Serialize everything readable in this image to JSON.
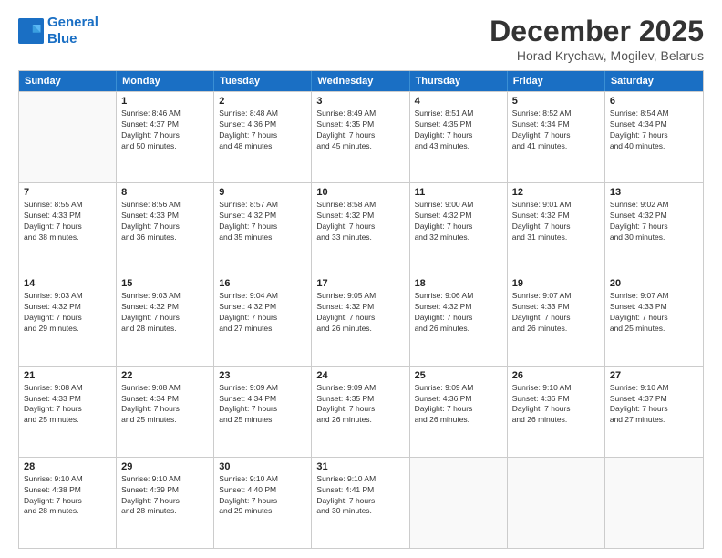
{
  "header": {
    "logo_line1": "General",
    "logo_line2": "Blue",
    "month": "December 2025",
    "location": "Horad Krychaw, Mogilev, Belarus"
  },
  "weekdays": [
    "Sunday",
    "Monday",
    "Tuesday",
    "Wednesday",
    "Thursday",
    "Friday",
    "Saturday"
  ],
  "rows": [
    [
      {
        "day": "",
        "info": ""
      },
      {
        "day": "1",
        "info": "Sunrise: 8:46 AM\nSunset: 4:37 PM\nDaylight: 7 hours\nand 50 minutes."
      },
      {
        "day": "2",
        "info": "Sunrise: 8:48 AM\nSunset: 4:36 PM\nDaylight: 7 hours\nand 48 minutes."
      },
      {
        "day": "3",
        "info": "Sunrise: 8:49 AM\nSunset: 4:35 PM\nDaylight: 7 hours\nand 45 minutes."
      },
      {
        "day": "4",
        "info": "Sunrise: 8:51 AM\nSunset: 4:35 PM\nDaylight: 7 hours\nand 43 minutes."
      },
      {
        "day": "5",
        "info": "Sunrise: 8:52 AM\nSunset: 4:34 PM\nDaylight: 7 hours\nand 41 minutes."
      },
      {
        "day": "6",
        "info": "Sunrise: 8:54 AM\nSunset: 4:34 PM\nDaylight: 7 hours\nand 40 minutes."
      }
    ],
    [
      {
        "day": "7",
        "info": "Sunrise: 8:55 AM\nSunset: 4:33 PM\nDaylight: 7 hours\nand 38 minutes."
      },
      {
        "day": "8",
        "info": "Sunrise: 8:56 AM\nSunset: 4:33 PM\nDaylight: 7 hours\nand 36 minutes."
      },
      {
        "day": "9",
        "info": "Sunrise: 8:57 AM\nSunset: 4:32 PM\nDaylight: 7 hours\nand 35 minutes."
      },
      {
        "day": "10",
        "info": "Sunrise: 8:58 AM\nSunset: 4:32 PM\nDaylight: 7 hours\nand 33 minutes."
      },
      {
        "day": "11",
        "info": "Sunrise: 9:00 AM\nSunset: 4:32 PM\nDaylight: 7 hours\nand 32 minutes."
      },
      {
        "day": "12",
        "info": "Sunrise: 9:01 AM\nSunset: 4:32 PM\nDaylight: 7 hours\nand 31 minutes."
      },
      {
        "day": "13",
        "info": "Sunrise: 9:02 AM\nSunset: 4:32 PM\nDaylight: 7 hours\nand 30 minutes."
      }
    ],
    [
      {
        "day": "14",
        "info": "Sunrise: 9:03 AM\nSunset: 4:32 PM\nDaylight: 7 hours\nand 29 minutes."
      },
      {
        "day": "15",
        "info": "Sunrise: 9:03 AM\nSunset: 4:32 PM\nDaylight: 7 hours\nand 28 minutes."
      },
      {
        "day": "16",
        "info": "Sunrise: 9:04 AM\nSunset: 4:32 PM\nDaylight: 7 hours\nand 27 minutes."
      },
      {
        "day": "17",
        "info": "Sunrise: 9:05 AM\nSunset: 4:32 PM\nDaylight: 7 hours\nand 26 minutes."
      },
      {
        "day": "18",
        "info": "Sunrise: 9:06 AM\nSunset: 4:32 PM\nDaylight: 7 hours\nand 26 minutes."
      },
      {
        "day": "19",
        "info": "Sunrise: 9:07 AM\nSunset: 4:33 PM\nDaylight: 7 hours\nand 26 minutes."
      },
      {
        "day": "20",
        "info": "Sunrise: 9:07 AM\nSunset: 4:33 PM\nDaylight: 7 hours\nand 25 minutes."
      }
    ],
    [
      {
        "day": "21",
        "info": "Sunrise: 9:08 AM\nSunset: 4:33 PM\nDaylight: 7 hours\nand 25 minutes."
      },
      {
        "day": "22",
        "info": "Sunrise: 9:08 AM\nSunset: 4:34 PM\nDaylight: 7 hours\nand 25 minutes."
      },
      {
        "day": "23",
        "info": "Sunrise: 9:09 AM\nSunset: 4:34 PM\nDaylight: 7 hours\nand 25 minutes."
      },
      {
        "day": "24",
        "info": "Sunrise: 9:09 AM\nSunset: 4:35 PM\nDaylight: 7 hours\nand 26 minutes."
      },
      {
        "day": "25",
        "info": "Sunrise: 9:09 AM\nSunset: 4:36 PM\nDaylight: 7 hours\nand 26 minutes."
      },
      {
        "day": "26",
        "info": "Sunrise: 9:10 AM\nSunset: 4:36 PM\nDaylight: 7 hours\nand 26 minutes."
      },
      {
        "day": "27",
        "info": "Sunrise: 9:10 AM\nSunset: 4:37 PM\nDaylight: 7 hours\nand 27 minutes."
      }
    ],
    [
      {
        "day": "28",
        "info": "Sunrise: 9:10 AM\nSunset: 4:38 PM\nDaylight: 7 hours\nand 28 minutes."
      },
      {
        "day": "29",
        "info": "Sunrise: 9:10 AM\nSunset: 4:39 PM\nDaylight: 7 hours\nand 28 minutes."
      },
      {
        "day": "30",
        "info": "Sunrise: 9:10 AM\nSunset: 4:40 PM\nDaylight: 7 hours\nand 29 minutes."
      },
      {
        "day": "31",
        "info": "Sunrise: 9:10 AM\nSunset: 4:41 PM\nDaylight: 7 hours\nand 30 minutes."
      },
      {
        "day": "",
        "info": ""
      },
      {
        "day": "",
        "info": ""
      },
      {
        "day": "",
        "info": ""
      }
    ]
  ]
}
